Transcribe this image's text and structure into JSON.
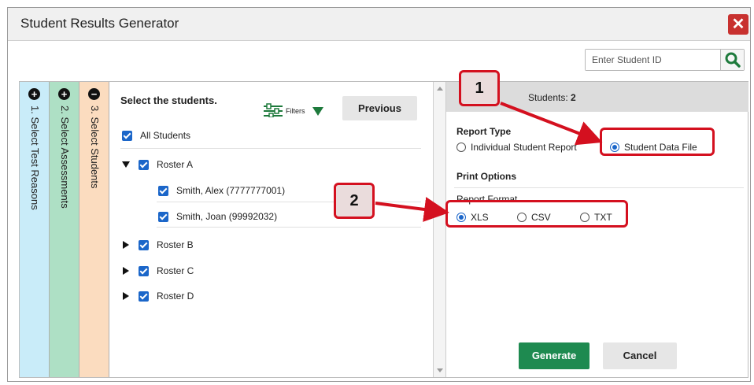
{
  "dialog": {
    "title": "Student Results Generator",
    "close_icon": "close-icon",
    "search": {
      "placeholder": "Enter Student ID",
      "icon": "search-icon"
    }
  },
  "steps": [
    {
      "icon": "plus-circle-icon",
      "label": "1. Select Test Reasons",
      "color": "#c9ecf9"
    },
    {
      "icon": "plus-circle-icon",
      "label": "2. Select Assessments",
      "color": "#aee0c5"
    },
    {
      "icon": "minus-circle-icon",
      "label": "3. Select Students",
      "color": "#fbdcbf"
    }
  ],
  "students_pane": {
    "heading": "Select the students.",
    "filters_label": "Filters",
    "previous_label": "Previous",
    "all_students": "All Students",
    "rosters": [
      {
        "name": "Roster A",
        "expanded": true,
        "students": [
          "Smith, Alex (7777777001)",
          "Smith, Joan (99992032)"
        ]
      },
      {
        "name": "Roster B",
        "expanded": false
      },
      {
        "name": "Roster C",
        "expanded": false
      },
      {
        "name": "Roster D",
        "expanded": false
      }
    ]
  },
  "options_pane": {
    "students_label": "Students:",
    "students_count": "2",
    "report_type_title": "Report Type",
    "report_types": [
      {
        "label": "Individual Student Report",
        "selected": false
      },
      {
        "label": "Student Data File",
        "selected": true
      }
    ],
    "print_options_title": "Print Options",
    "report_format_title": "Report Format",
    "formats": [
      {
        "label": "XLS",
        "selected": true
      },
      {
        "label": "CSV",
        "selected": false
      },
      {
        "label": "TXT",
        "selected": false
      }
    ],
    "generate_label": "Generate",
    "cancel_label": "Cancel"
  },
  "callouts": [
    {
      "number": "1"
    },
    {
      "number": "2"
    }
  ],
  "colors": {
    "accent": "#1b66c9",
    "callout": "#d4101f",
    "generate": "#1e8a50",
    "close": "#c8312f"
  }
}
